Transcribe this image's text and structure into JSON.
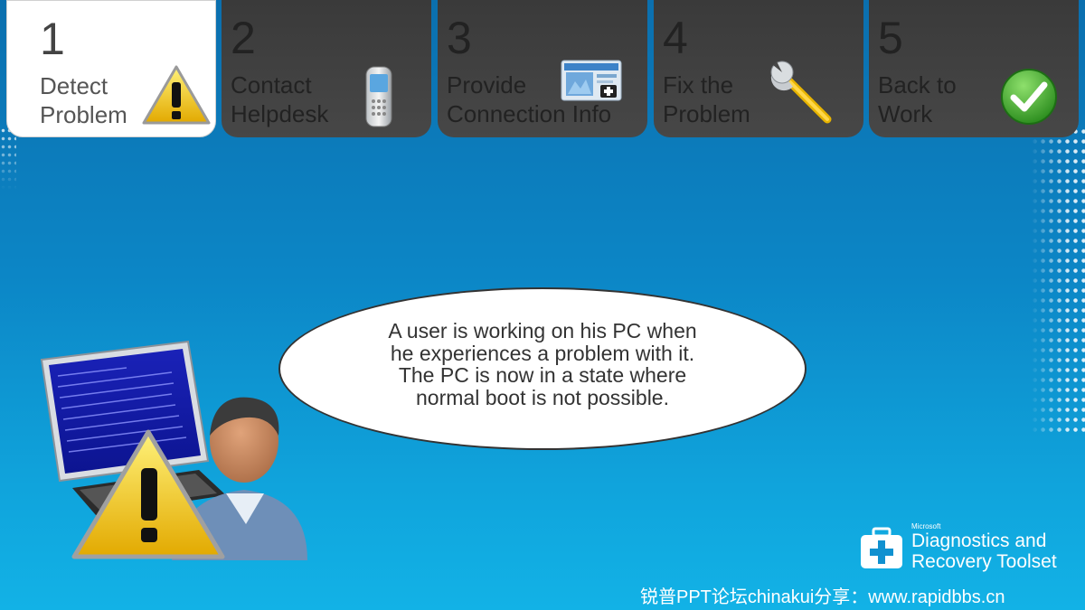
{
  "steps": [
    {
      "number": "1",
      "label_line1": "Detect",
      "label_line2": "Problem",
      "icon": "warning-icon",
      "active": true
    },
    {
      "number": "2",
      "label_line1": "Contact",
      "label_line2": "Helpdesk",
      "icon": "mobile-phone-icon",
      "active": false
    },
    {
      "number": "3",
      "label_line1": "Provide",
      "label_line2": "Connection Info",
      "icon": "connection-card-icon",
      "active": false
    },
    {
      "number": "4",
      "label_line1": "Fix the",
      "label_line2": "Problem",
      "icon": "wrench-icon",
      "active": false
    },
    {
      "number": "5",
      "label_line1": "Back to",
      "label_line2": "Work",
      "icon": "checkmark-icon",
      "active": false
    }
  ],
  "bubble": {
    "line1": "A user is working on his PC when",
    "line2": "he experiences a problem with it.",
    "line3": "The PC is now in a state where",
    "line4": "normal boot is not possible."
  },
  "brand": {
    "vendor": "Microsoft",
    "line1": "Diagnostics and",
    "line2": "Recovery Toolset"
  },
  "footer": {
    "text": "锐普PPT论坛chinakui分享：www.rapidbbs.cn"
  },
  "colors": {
    "background_top": "#0b6fae",
    "background_bottom": "#12b2e6",
    "tab_inactive": "#404040",
    "tab_active": "#ffffff",
    "warning_yellow": "#f3c316",
    "check_green": "#3aa829"
  }
}
